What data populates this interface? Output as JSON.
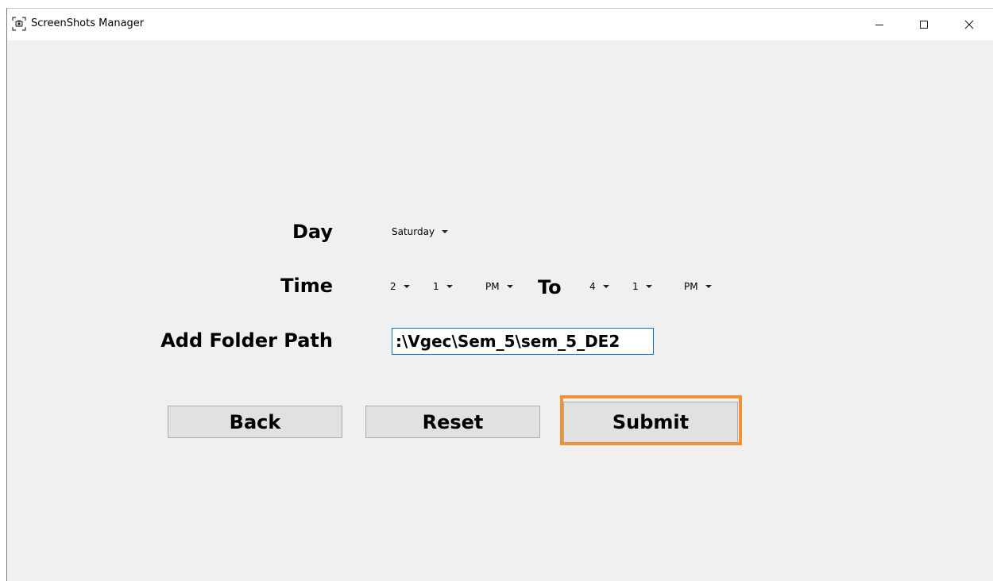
{
  "window": {
    "title": "ScreenShots Manager",
    "icon": "screenshot-app-icon",
    "controls": {
      "minimize": "minimize-icon",
      "maximize": "maximize-icon",
      "close": "close-icon"
    }
  },
  "form": {
    "day_label": "Day",
    "day_value": "Saturday",
    "time_label": "Time",
    "from_hour": "2",
    "from_minute": "1",
    "from_ampm": "PM",
    "to_label": "To",
    "to_hour": "4",
    "to_minute": "1",
    "to_ampm": "PM",
    "folder_label": "Add Folder Path",
    "folder_value": ":\\Vgec\\Sem_5\\sem_5_DE2"
  },
  "buttons": {
    "back": "Back",
    "reset": "Reset",
    "submit": "Submit"
  },
  "colors": {
    "window_bg": "#f0f0f0",
    "titlebar_bg": "#ffffff",
    "button_bg": "#e1e1e1",
    "input_border": "#0078d7",
    "highlight": "#f29236"
  }
}
